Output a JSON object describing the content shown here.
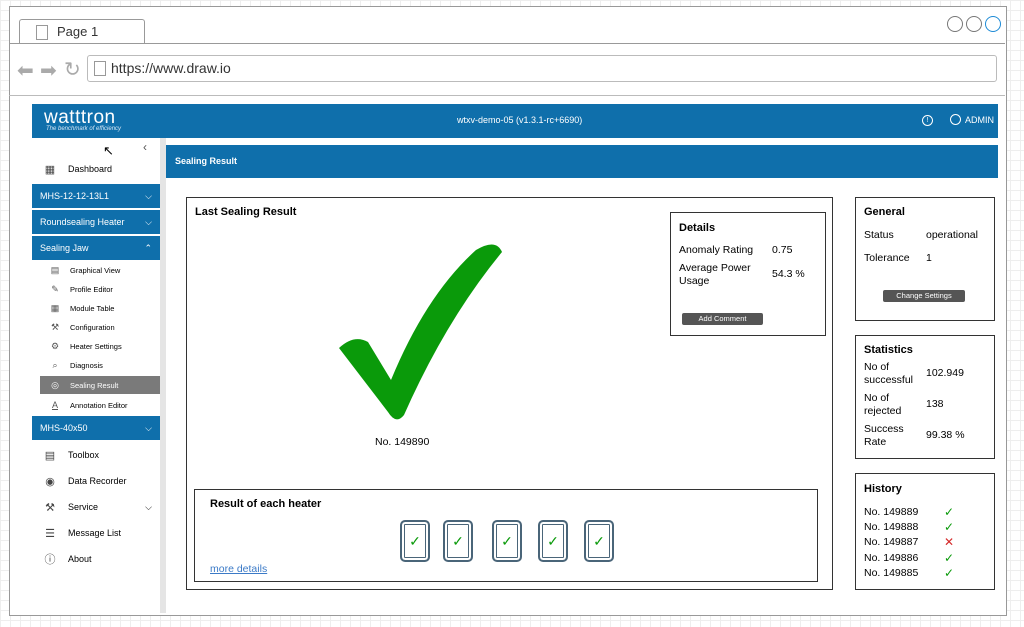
{
  "browser": {
    "tab_label": "Page 1",
    "url": "https://www.draw.io"
  },
  "app": {
    "logo": "watttron",
    "tagline": "The benchmark of efficiency",
    "title": "wtxv-demo-05 (v1.3.1-rc+6690)",
    "user": "ADMIN",
    "accent": "#0f6fab"
  },
  "sidebar": {
    "dashboard": "Dashboard",
    "groups": [
      "MHS-12-12-13L1",
      "Roundsealing Heater",
      "Sealing Jaw",
      "MHS-40x50"
    ],
    "subitems": [
      "Graphical View",
      "Profile Editor",
      "Module Table",
      "Configuration",
      "Heater Settings",
      "Diagnosis",
      "Sealing Result",
      "Annotation Editor"
    ],
    "bottom": [
      "Toolbox",
      "Data Recorder",
      "Service",
      "Message List",
      "About"
    ]
  },
  "page": {
    "header": "Sealing Result"
  },
  "last_result": {
    "title": "Last Sealing Result",
    "number": "No. 149890"
  },
  "details": {
    "title": "Details",
    "anomaly_label": "Anomaly Rating",
    "anomaly_value": "0.75",
    "power_label": "Average Power Usage",
    "power_value": "54.3 %",
    "button": "Add Comment"
  },
  "heaters": {
    "title": "Result of each heater",
    "link": "more details"
  },
  "general": {
    "title": "General",
    "status_label": "Status",
    "status_value": "operational",
    "tolerance_label": "Tolerance",
    "tolerance_value": "1",
    "button": "Change Settings"
  },
  "statistics": {
    "title": "Statistics",
    "successful_label": "No of successful",
    "successful_value": "102.949",
    "rejected_label": "No of rejected",
    "rejected_value": "138",
    "rate_label": "Success Rate",
    "rate_value": "99.38 %"
  },
  "history": {
    "title": "History",
    "items": [
      {
        "label": "No. 149889",
        "ok": true
      },
      {
        "label": "No. 149888",
        "ok": true
      },
      {
        "label": "No. 149887",
        "ok": false
      },
      {
        "label": "No. 149886",
        "ok": true
      },
      {
        "label": "No. 149885",
        "ok": true
      }
    ]
  }
}
